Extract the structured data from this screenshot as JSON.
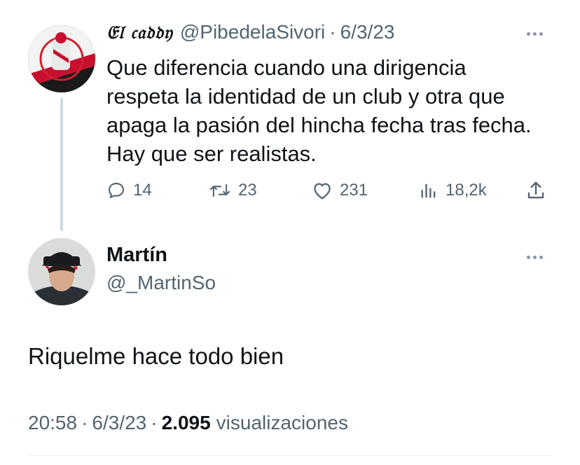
{
  "parent_tweet": {
    "display_name": "𝔈𝔩 𝔠𝔞𝔡𝔡𝔶",
    "handle": "@PibedelaSivori",
    "separator": "·",
    "date": "6/3/23",
    "text_lines": [
      "Que diferencia cuando una dirigencia",
      "respeta la identidad de un club y otra que",
      "apaga la pasión del hincha fecha tras fecha.",
      "Hay que ser realistas."
    ],
    "replies": "14",
    "retweets": "23",
    "likes": "231",
    "views": "18,2k"
  },
  "main_tweet": {
    "display_name": "Martín",
    "handle": "@_MartinSo",
    "text": "Riquelme hace todo bien",
    "time": "20:58",
    "separator": "·",
    "date": "6/3/23",
    "views_count": "2.095",
    "views_label": "visualizaciones"
  },
  "icons": {
    "reply": "reply-icon",
    "retweet": "retweet-icon",
    "like": "heart-icon",
    "views": "views-icon",
    "share": "share-icon",
    "more": "more-icon"
  },
  "colors": {
    "text": "#0f1419",
    "secondary": "#536471",
    "thread_line": "#cfd9de"
  }
}
